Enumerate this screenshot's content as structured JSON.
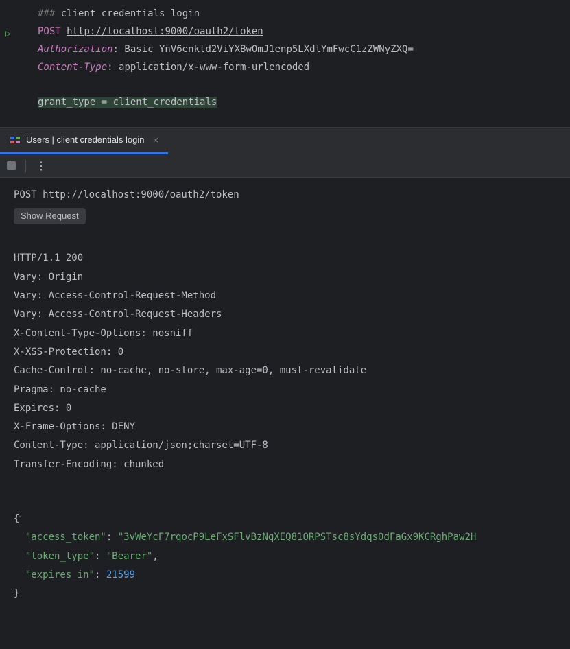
{
  "editor": {
    "comment_hash": "### ",
    "comment_text": "client credentials login",
    "method": "POST",
    "url": "http://localhost:9000/oauth2/token",
    "header1_name": "Authorization",
    "header1_value": ": Basic YnV6enktd2ViYXBwOmJ1enp5LXdlYmFwcC1zZWNyZXQ=",
    "header2_name": "Content-Type",
    "header2_value": ": application/x-www-form-urlencoded",
    "body": "grant_type = client_credentials"
  },
  "tab": {
    "title": "Users | client credentials login",
    "close": "×"
  },
  "toolbar": {
    "more": "⋮"
  },
  "response": {
    "request_line": "POST http://localhost:9000/oauth2/token",
    "show_request": "Show Request",
    "status": "HTTP/1.1 200",
    "headers": [
      "Vary: Origin",
      "Vary: Access-Control-Request-Method",
      "Vary: Access-Control-Request-Headers",
      "X-Content-Type-Options: nosniff",
      "X-XSS-Protection: 0",
      "Cache-Control: no-cache, no-store, max-age=0, must-revalidate",
      "Pragma: no-cache",
      "Expires: 0",
      "X-Frame-Options: DENY",
      "Content-Type: application/json;charset=UTF-8",
      "Transfer-Encoding: chunked"
    ],
    "json_open": "{",
    "json_key1": "\"access_token\"",
    "json_val1": "\"3vWeYcF7rqocP9LeFxSFlvBzNqXEQ81ORPSTsc8sYdqs0dFaGx9KCRghPaw2H",
    "json_key2": "\"token_type\"",
    "json_val2": "\"Bearer\"",
    "json_key3": "\"expires_in\"",
    "json_val3": "21599",
    "json_close": "}",
    "colon": ": ",
    "comma": ","
  }
}
